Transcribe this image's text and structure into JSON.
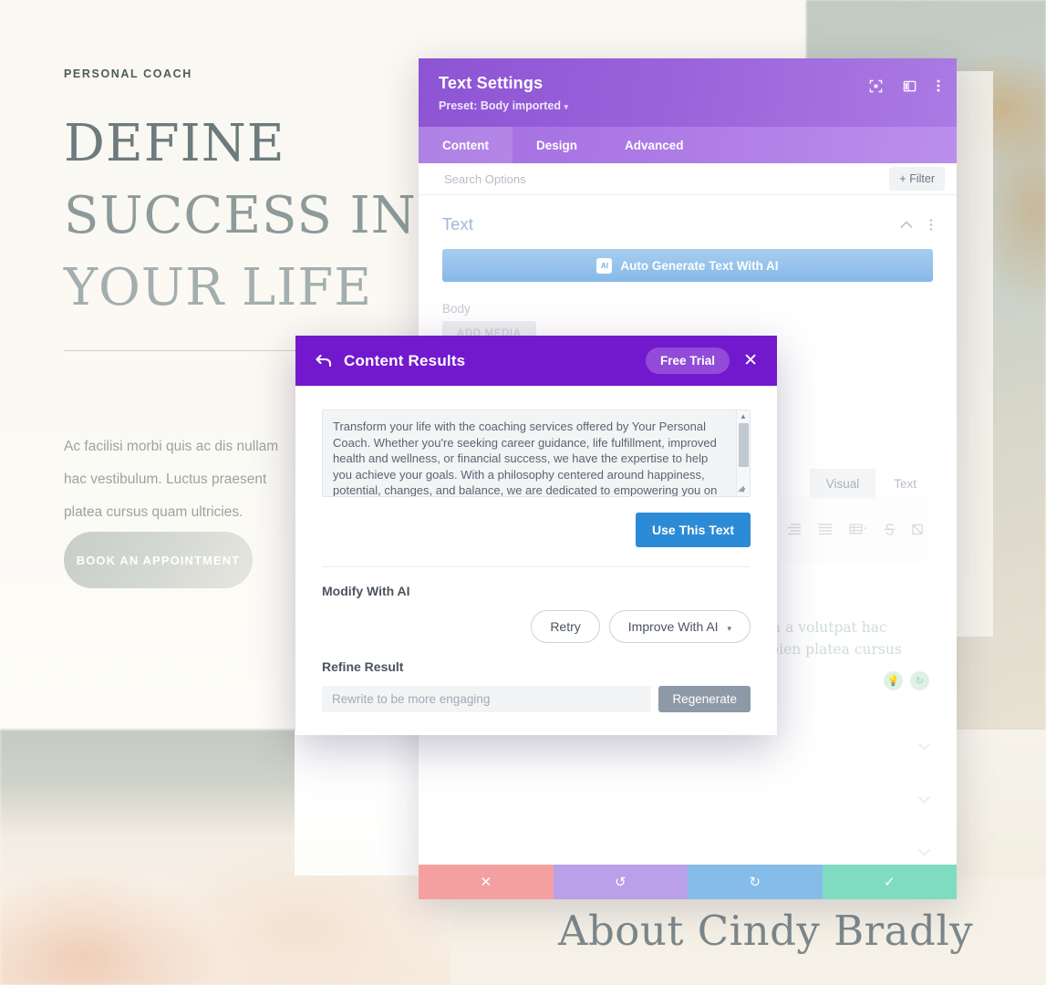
{
  "website": {
    "eyebrow": "PERSONAL COACH",
    "title_line1": "DEFINE",
    "title_line2": "SUCCESS IN",
    "title_line3": "YOUR LIFE",
    "body_visible": "Ac facilisi morbi quis ac dis nullam",
    "body_line2": "hac vestibulum. Luctus praesent",
    "body_line3": "platea cursus quam ultricies.",
    "cta_label": "BOOK AN APPOINTMENT",
    "about_heading": "About Cindy Bradly"
  },
  "settings_modal": {
    "title": "Text Settings",
    "preset": "Preset: Body imported",
    "preset_caret": "▾",
    "header_icons": [
      "fullscreen-icon",
      "layout-columns-icon",
      "more-vertical-icon"
    ],
    "tabs": [
      {
        "label": "Content",
        "active": true
      },
      {
        "label": "Design",
        "active": false
      },
      {
        "label": "Advanced",
        "active": false
      }
    ],
    "search_placeholder": "Search Options",
    "search_value": "",
    "filter_label": "Filter",
    "filter_plus": "+",
    "section": {
      "title": "Text",
      "collapse_icon": "chevron-up-icon",
      "more_icon": "more-vertical-icon"
    },
    "ai_generate_label": "Auto Generate Text With AI",
    "ai_chip_label": "AI",
    "body_field_label": "Body",
    "add_media_label": "ADD MEDIA",
    "editor_tabs": [
      {
        "label": "Visual",
        "active": true
      },
      {
        "label": "Text",
        "active": false
      }
    ],
    "toolbar_icons": [
      "align-right-icon",
      "align-justify-icon",
      "table-icon",
      "strikethrough-icon",
      "remove-format-icon"
    ],
    "editor_preview_line1": "ulla a volutpat hac",
    "editor_preview_line2": "sapien platea cursus",
    "editor_badges": [
      "lightbulb-icon",
      "refresh-icon"
    ],
    "collapsed_sections": 3,
    "footer": [
      {
        "name": "cancel",
        "icon": "✕",
        "color": "#f4a0a0"
      },
      {
        "name": "undo",
        "icon": "↺",
        "color": "#b9a0e8"
      },
      {
        "name": "redo",
        "icon": "↻",
        "color": "#86bce8"
      },
      {
        "name": "save",
        "icon": "✓",
        "color": "#7fdcc0"
      }
    ]
  },
  "content_results": {
    "back_icon": "back-arrow-icon",
    "title": "Content Results",
    "free_trial_label": "Free Trial",
    "close_icon": "✕",
    "result_text": "Transform your life with the coaching services offered by Your Personal Coach. Whether you're seeking career guidance, life fulfillment, improved health and wellness, or financial success, we have the expertise to help you achieve your goals. With a philosophy centered around happiness, potential, changes, and balance, we are dedicated to empowering you on your journey. Together, we will",
    "use_this_text_label": "Use This Text",
    "modify_with_ai_label": "Modify With AI",
    "retry_label": "Retry",
    "improve_with_ai_label": "Improve With AI",
    "improve_caret": "▾",
    "refine_result_label": "Refine Result",
    "refine_placeholder": "Rewrite to be more engaging",
    "refine_value": "",
    "regenerate_label": "Regenerate"
  },
  "colors": {
    "settings_header_purple": "#9a62da",
    "settings_tabs_purple": "#af7ce6",
    "dialog_purple": "#7219cd",
    "use_text_blue": "#2c8bd6",
    "ai_button_blue": "#86b9e8",
    "footer_cancel": "#f4a0a0",
    "footer_undo": "#b9a0e8",
    "footer_redo": "#86bce8",
    "footer_save": "#7fdcc0"
  }
}
